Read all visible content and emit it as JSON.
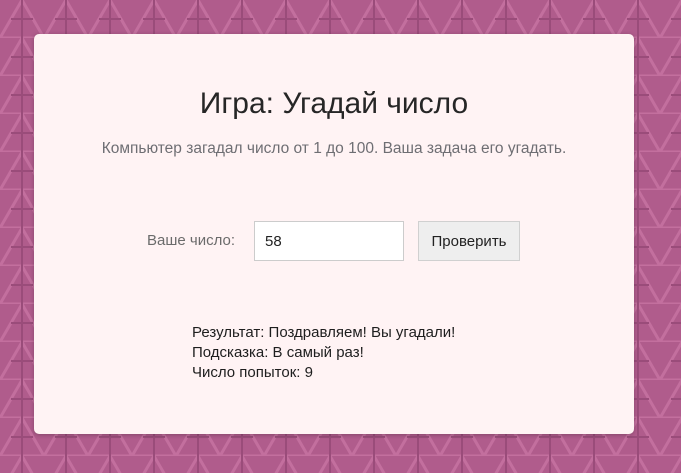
{
  "game": {
    "title": "Игра: Угадай число",
    "description": "Компьютер загадал число от 1 до 100. Ваша задача его угадать.",
    "guess_label": "Ваше число:",
    "guess_value": "58",
    "check_button_label": "Проверить",
    "result_line": "Результат: Поздравляем! Вы угадали!",
    "hint_line": "Подсказка: В самый раз!",
    "attempts_line": "Число попыток: 9"
  },
  "colors": {
    "background": "#b05c8c",
    "card": "#fff3f4"
  }
}
